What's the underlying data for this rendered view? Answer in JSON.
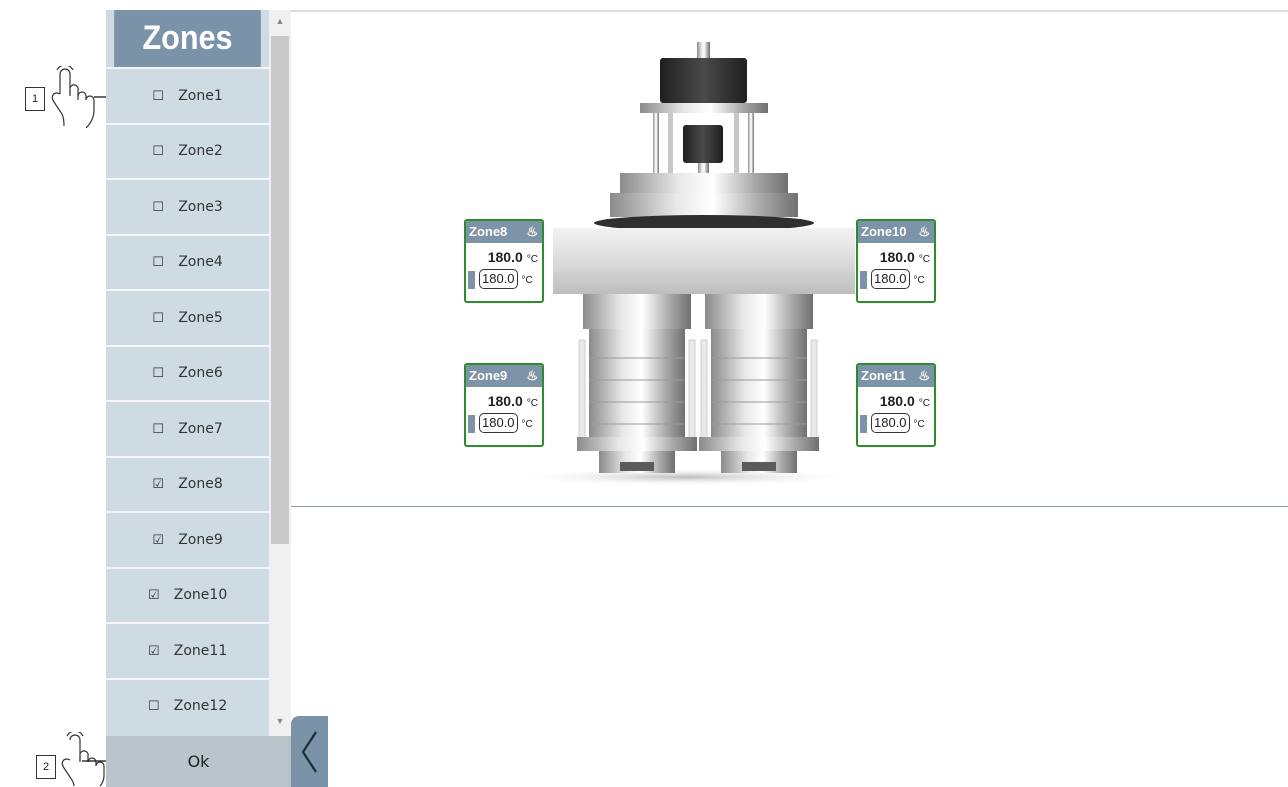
{
  "panel": {
    "title": "Zones",
    "ok_label": "Ok",
    "items": [
      {
        "label": "Zone1",
        "checked": false,
        "mark": "☐"
      },
      {
        "label": "Zone2",
        "checked": false,
        "mark": "☐"
      },
      {
        "label": "Zone3",
        "checked": false,
        "mark": "☐"
      },
      {
        "label": "Zone4",
        "checked": false,
        "mark": "☐"
      },
      {
        "label": "Zone5",
        "checked": false,
        "mark": "☐"
      },
      {
        "label": "Zone6",
        "checked": false,
        "mark": "☐"
      },
      {
        "label": "Zone7",
        "checked": false,
        "mark": "☐"
      },
      {
        "label": "Zone8",
        "checked": true,
        "mark": "☑"
      },
      {
        "label": "Zone9",
        "checked": true,
        "mark": "☑"
      },
      {
        "label": "Zone10",
        "checked": true,
        "mark": "☑"
      },
      {
        "label": "Zone11",
        "checked": true,
        "mark": "☑"
      },
      {
        "label": "Zone12",
        "checked": false,
        "mark": "☐"
      }
    ]
  },
  "widgets": [
    {
      "name": "Zone8",
      "actual": "180.0",
      "setpoint": "180.0",
      "unit": "°C"
    },
    {
      "name": "Zone9",
      "actual": "180.0",
      "setpoint": "180.0",
      "unit": "°C"
    },
    {
      "name": "Zone10",
      "actual": "180.0",
      "setpoint": "180.0",
      "unit": "°C"
    },
    {
      "name": "Zone11",
      "actual": "180.0",
      "setpoint": "180.0",
      "unit": "°C"
    }
  ],
  "annotations": {
    "step1": "1",
    "step2": "2"
  },
  "colors": {
    "header": "#7b93a9",
    "panel_bg": "#cfdbe3",
    "widget_border": "#2e8b2e"
  },
  "icons": {
    "heater": "heat-icon",
    "hand": "hand-pointer-icon",
    "collapse": "chevron-left-icon"
  }
}
